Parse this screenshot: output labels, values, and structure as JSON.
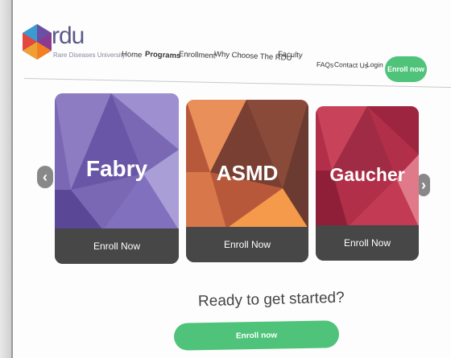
{
  "brand": {
    "logo_word": "rdu",
    "logo_subtitle": "Rare Diseases University"
  },
  "nav": {
    "home": "Home",
    "programs": "Programs",
    "enrollment": "Enrollment",
    "why": "Why Choose The RDU",
    "faculty": "Faculty",
    "faqs": "FAQs",
    "contact": "Contact Us",
    "login": "Login",
    "enroll_button": "Enroll now"
  },
  "carousel": {
    "prev_icon": "chevron-left-icon",
    "next_icon": "chevron-right-icon",
    "cards": [
      {
        "title": "Fabry",
        "button": "Enroll Now",
        "color": "#7b68b5"
      },
      {
        "title": "ASMD",
        "button": "Enroll Now",
        "color": "#c0603a"
      },
      {
        "title": "Gaucher",
        "button": "Enroll Now",
        "color": "#b12f48"
      }
    ]
  },
  "cta": {
    "heading": "Ready to get started?",
    "button": "Enroll now"
  },
  "colors": {
    "accent": "#4fc37a",
    "card_footer": "#474747"
  }
}
